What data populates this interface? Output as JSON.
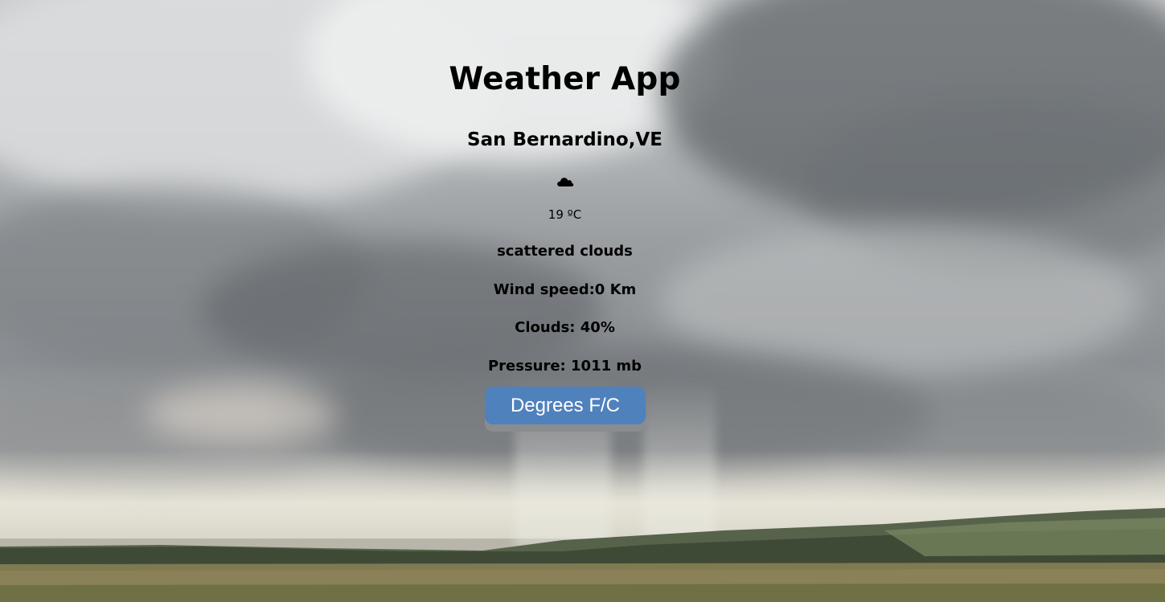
{
  "app": {
    "title": "Weather App"
  },
  "weather": {
    "location": "San Bernardino,VE",
    "icon": "cloud-icon",
    "temperature": "19 ºC",
    "description": "scattered clouds",
    "wind_speed": "Wind speed:0 Km",
    "clouds": "Clouds: 40%",
    "pressure": "Pressure: 1011 mb"
  },
  "controls": {
    "toggle_units_label": "Degrees F/C"
  },
  "colors": {
    "button_bg": "#4f81bd",
    "button_shadow": "#8a8c8e",
    "button_text": "#ffffff",
    "text": "#000000"
  }
}
